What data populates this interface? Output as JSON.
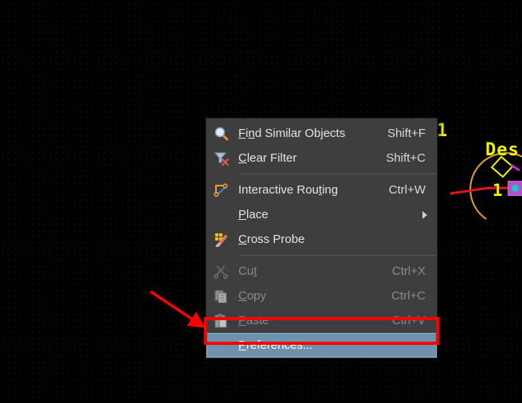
{
  "canvas": {
    "name": "pcb-editor-canvas",
    "background_color": "#000000",
    "grid_dot_color": "#1b1b1b"
  },
  "pcb": {
    "designator_text": "Des",
    "pin_number_left": "1",
    "pin_number_pad": "1",
    "pad_color": "#b44fd0",
    "pad_hole_color": "#1fc4c4",
    "trace_color": "#e01818",
    "arc_color": "#e0a030",
    "outline_color": "#f2f20a",
    "text_color": "#f2f20a"
  },
  "context_menu": {
    "name": "pcb-context-menu",
    "background_color": "#3e3e3e",
    "highlight_color": "#6e91ae",
    "items": [
      {
        "label": "Find Similar Objects",
        "mnemonic": "n",
        "accel": "Shift+F",
        "icon": "magnifier-icon",
        "enabled": true,
        "selected": false,
        "submenu": false
      },
      {
        "label": "Clear Filter",
        "mnemonic": "C",
        "accel": "Shift+C",
        "icon": "filter-clear-icon",
        "enabled": true,
        "selected": false,
        "submenu": false
      },
      {
        "label": "Interactive Routing",
        "mnemonic": "t",
        "accel": "Ctrl+W",
        "icon": "interactive-routing-icon",
        "enabled": true,
        "selected": false,
        "submenu": false
      },
      {
        "label": "Place",
        "mnemonic": "P",
        "accel": "",
        "icon": "",
        "enabled": true,
        "selected": false,
        "submenu": true
      },
      {
        "label": "Cross Probe",
        "mnemonic": "C",
        "accel": "",
        "icon": "cross-probe-icon",
        "enabled": true,
        "selected": false,
        "submenu": false
      },
      {
        "label": "Cut",
        "mnemonic": "t",
        "accel": "Ctrl+X",
        "icon": "scissors-icon",
        "enabled": false,
        "selected": false,
        "submenu": false
      },
      {
        "label": "Copy",
        "mnemonic": "C",
        "accel": "Ctrl+C",
        "icon": "copy-icon",
        "enabled": false,
        "selected": false,
        "submenu": false
      },
      {
        "label": "Paste",
        "mnemonic": "P",
        "accel": "Ctrl+V",
        "icon": "paste-icon",
        "enabled": false,
        "selected": false,
        "submenu": false
      },
      {
        "label": "Preferences...",
        "mnemonic": "P",
        "accel": "",
        "icon": "",
        "enabled": true,
        "selected": true,
        "submenu": false
      }
    ]
  },
  "annotations": {
    "highlight_box_color": "#fb0000",
    "arrow_color": "#fb0000",
    "arrow_target": "Preferences..."
  }
}
